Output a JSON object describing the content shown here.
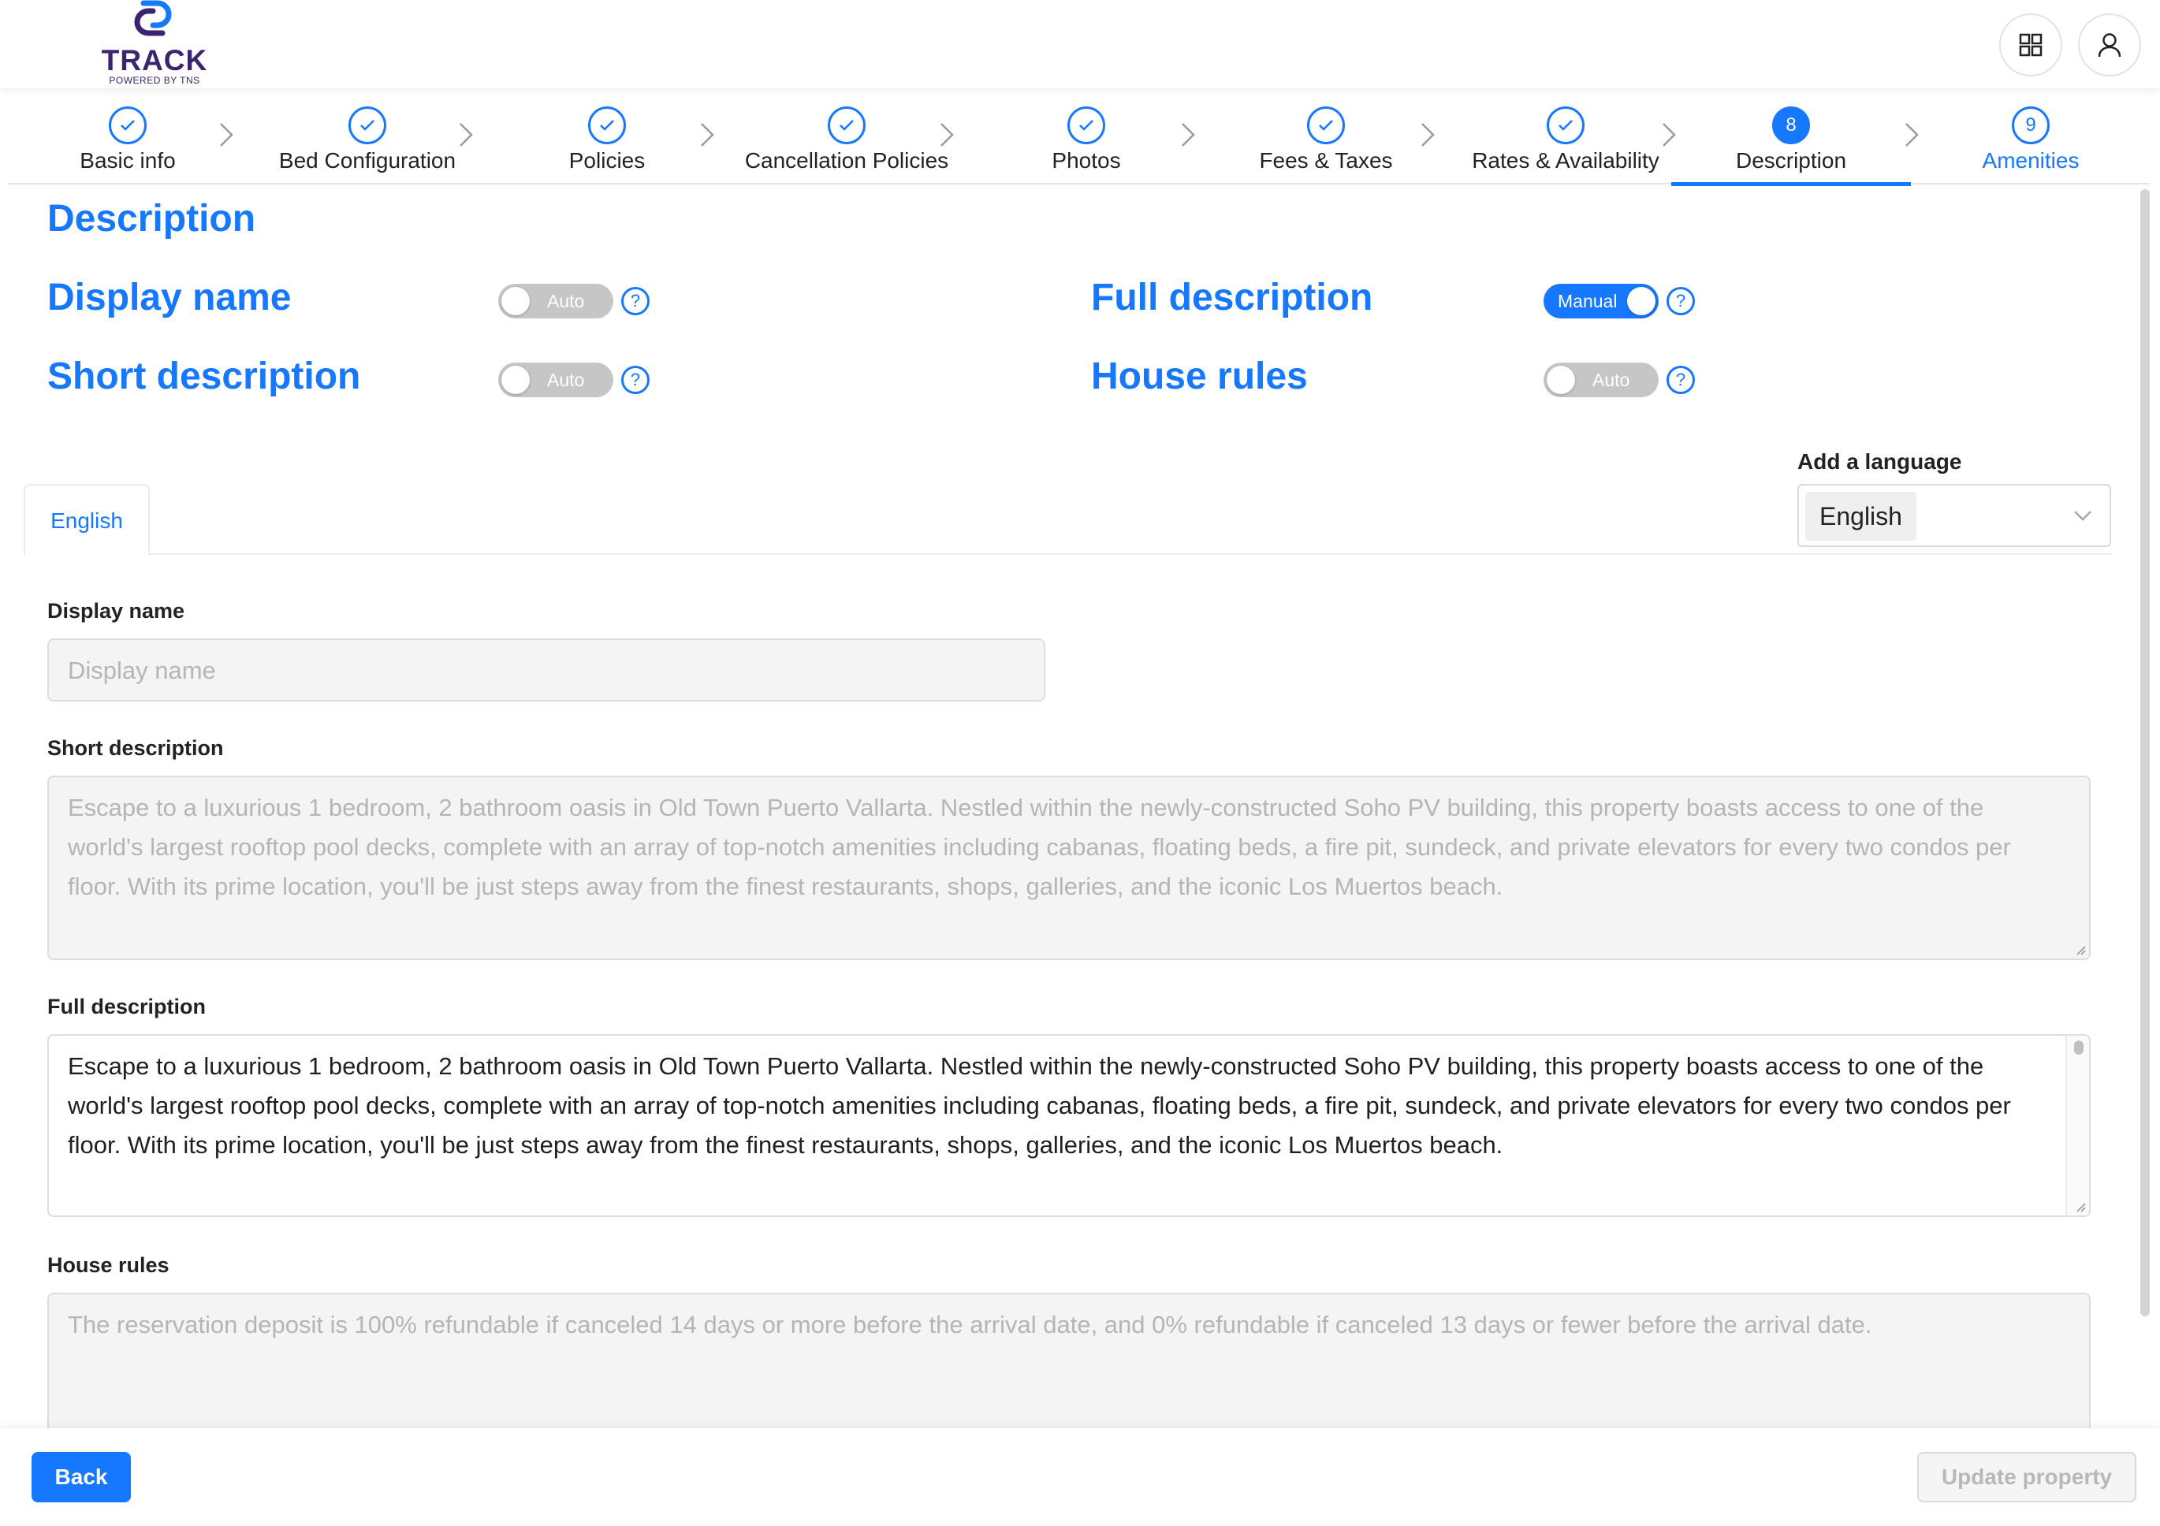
{
  "header": {
    "logo_text": "TRACK",
    "logo_subtext": "POWERED BY TNS",
    "apps_icon": "grid-icon",
    "user_icon": "user-icon"
  },
  "steps": [
    {
      "label": "Basic info",
      "state": "done"
    },
    {
      "label": "Bed Configuration",
      "state": "done"
    },
    {
      "label": "Policies",
      "state": "done"
    },
    {
      "label": "Cancellation Policies",
      "state": "done"
    },
    {
      "label": "Photos",
      "state": "done"
    },
    {
      "label": "Fees & Taxes",
      "state": "done"
    },
    {
      "label": "Rates & Availability",
      "state": "done"
    },
    {
      "label": "Description",
      "state": "active",
      "number": "8"
    },
    {
      "label": "Amenities",
      "state": "next",
      "number": "9"
    }
  ],
  "page": {
    "title": "Description"
  },
  "settings": {
    "display_name": {
      "label": "Display name",
      "toggle": "Auto",
      "on": false
    },
    "short_description": {
      "label": "Short description",
      "toggle": "Auto",
      "on": false
    },
    "full_description": {
      "label": "Full description",
      "toggle": "Manual",
      "on": true
    },
    "house_rules": {
      "label": "House rules",
      "toggle": "Auto",
      "on": false
    },
    "help_glyph": "?"
  },
  "language": {
    "add_label": "Add a language",
    "selected": "English",
    "tab": "English"
  },
  "form": {
    "display_name": {
      "label": "Display name",
      "placeholder": "Display name"
    },
    "short_description": {
      "label": "Short description",
      "value": "Escape to a luxurious 1 bedroom, 2 bathroom oasis in Old Town Puerto Vallarta. Nestled within the newly-constructed Soho PV building, this property boasts access to one of the world's largest rooftop pool decks, complete with an array of top-notch amenities including cabanas, floating beds, a fire pit, sundeck, and private elevators for every two condos per floor. With its prime location, you'll be just steps away from the finest restaurants, shops, galleries, and the iconic Los Muertos beach."
    },
    "full_description": {
      "label": "Full description",
      "value": "Escape to a luxurious 1 bedroom, 2 bathroom oasis in Old Town Puerto Vallarta. Nestled within the newly-constructed Soho PV building, this property boasts access to one of the world's largest rooftop pool decks, complete with an array of top-notch amenities including cabanas, floating beds, a fire pit, sundeck, and private elevators for every two condos per floor. With its prime location, you'll be just steps away from the finest restaurants, shops, galleries, and the iconic Los Muertos beach."
    },
    "house_rules": {
      "label": "House rules",
      "value": "The reservation deposit is 100% refundable if canceled 14 days or more before the arrival date, and 0% refundable if canceled 13 days or fewer before the arrival date."
    }
  },
  "footer": {
    "back": "Back",
    "update": "Update property"
  },
  "colors": {
    "accent": "#1677ff",
    "toggle_off": "#c6c6c6",
    "brand": "#3a2370"
  }
}
